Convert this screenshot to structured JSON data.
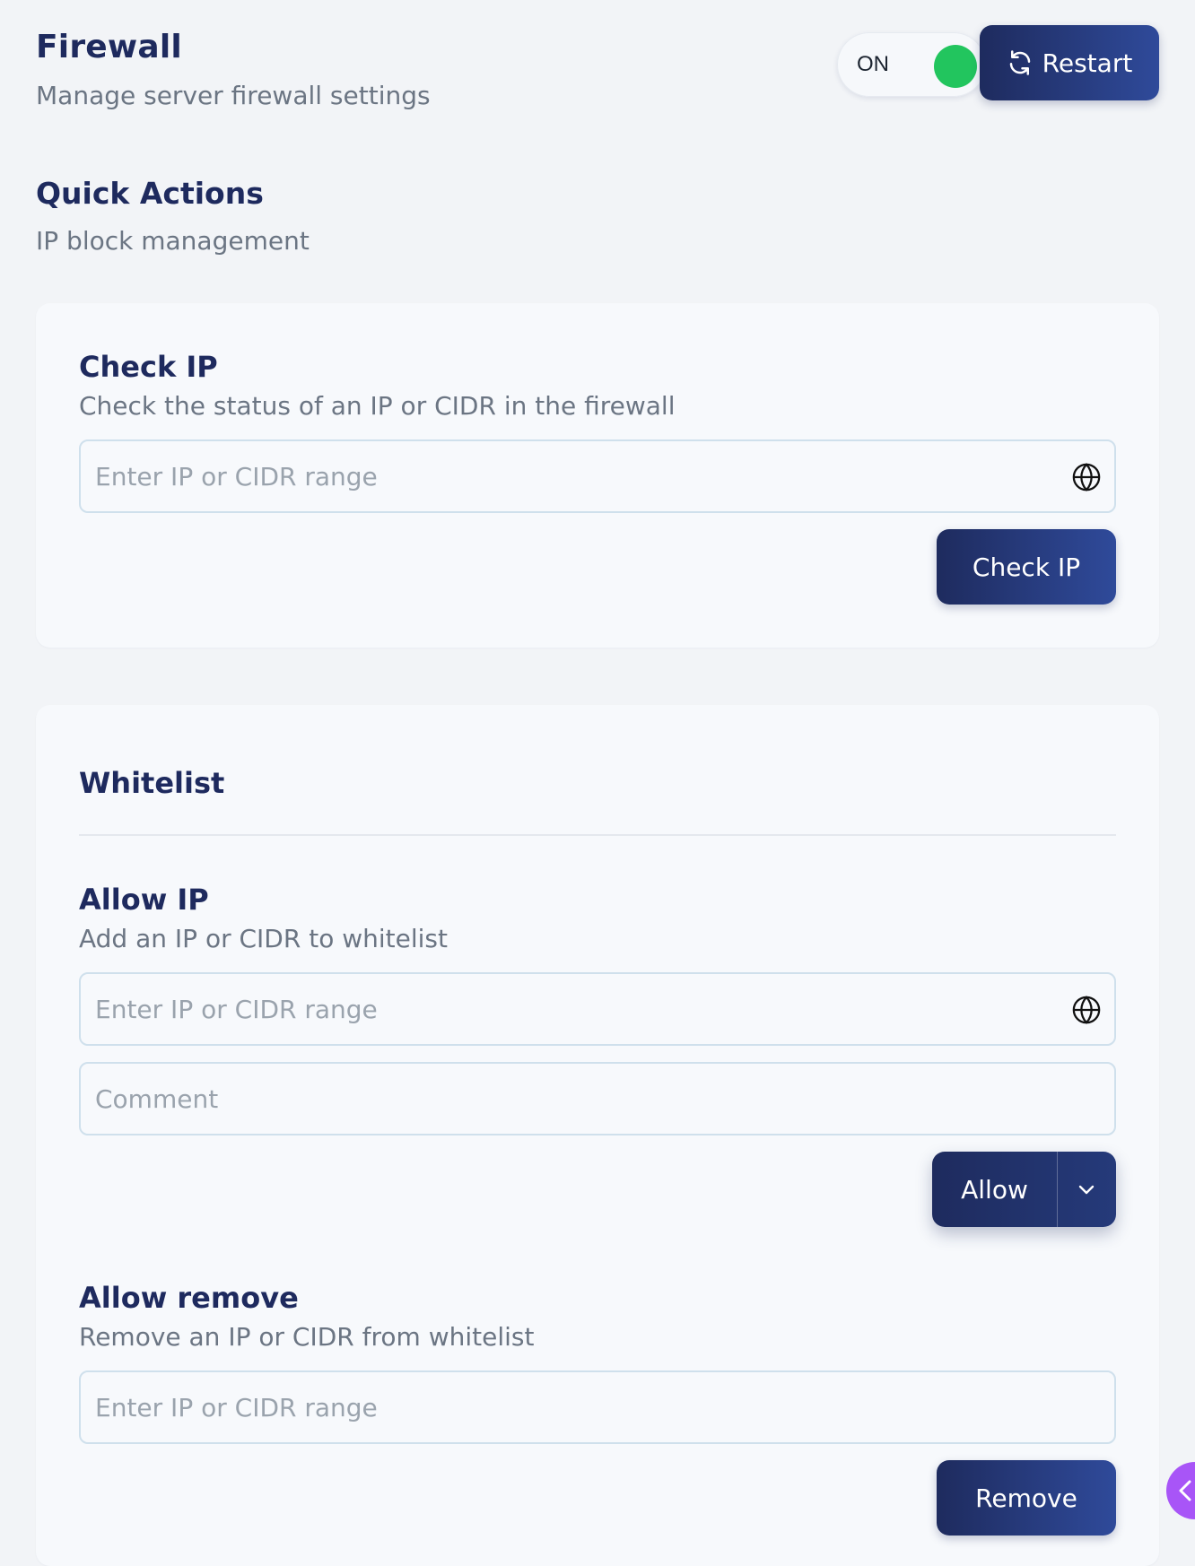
{
  "header": {
    "title": "Firewall",
    "subtitle": "Manage server firewall settings",
    "toggle": {
      "label": "ON",
      "state": "on",
      "color": "#22c55e"
    },
    "restart_label": "Restart"
  },
  "quick_actions": {
    "title": "Quick Actions",
    "subtitle": "IP block management"
  },
  "check_ip": {
    "title": "Check IP",
    "description": "Check the status of an IP or CIDR in the firewall",
    "input_placeholder": "Enter IP or CIDR range",
    "input_value": "",
    "input_icon": "globe-icon",
    "button_label": "Check IP"
  },
  "whitelist": {
    "title": "Whitelist",
    "allow_ip": {
      "title": "Allow IP",
      "description": "Add an IP or CIDR to whitelist",
      "ip_placeholder": "Enter IP or CIDR range",
      "ip_value": "",
      "ip_icon": "globe-icon",
      "comment_placeholder": "Comment",
      "comment_value": "",
      "button_label": "Allow",
      "dropdown_icon": "chevron-down-icon"
    },
    "allow_remove": {
      "title": "Allow remove",
      "description": "Remove an IP or CIDR from whitelist",
      "ip_placeholder": "Enter IP or CIDR range",
      "ip_value": "",
      "button_label": "Remove"
    }
  },
  "colors": {
    "primary": "#1e2b5e",
    "primary_gradient_end": "#2f4a9a",
    "accent_tab": "#a855f7",
    "background": "#f2f4f7"
  }
}
